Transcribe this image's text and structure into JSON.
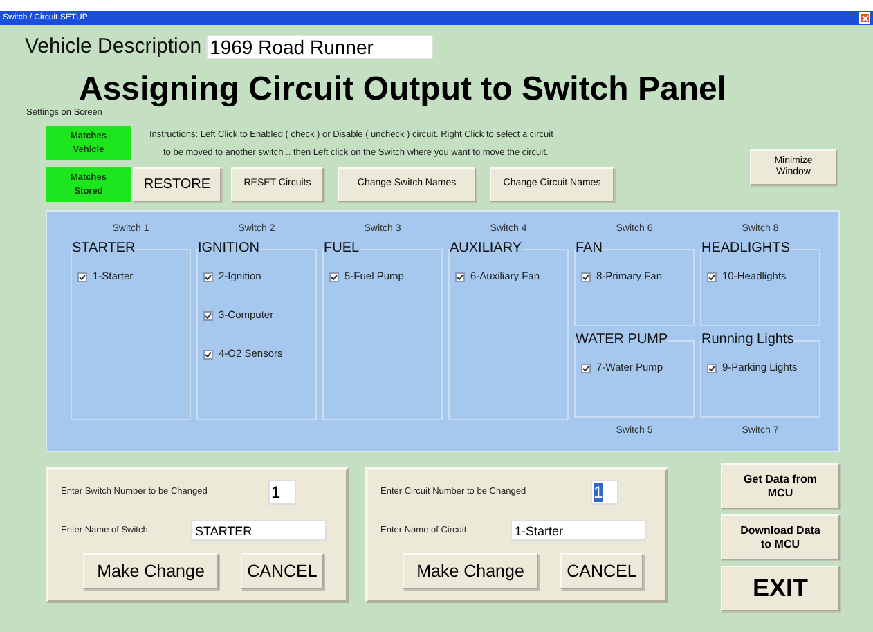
{
  "window": {
    "title": "Switch / Circuit SETUP"
  },
  "vehicle": {
    "label": "Vehicle Description",
    "value": "1969 Road Runner"
  },
  "heading": "Assigning Circuit Output to Switch Panel",
  "settings_label": "Settings on Screen",
  "indicators": [
    {
      "lines": [
        "Matches",
        "Vehicle"
      ],
      "color": "#1ee61e"
    },
    {
      "lines": [
        "Matches",
        "Stored"
      ],
      "color": "#1ee61e"
    }
  ],
  "instructions": [
    "Instructions:   Left Click to Enabled ( check ) or Disable ( uncheck ) circuit.   Right Click to select a circuit",
    "to be moved to another switch  ..  then Left click on the Switch where you want to move the circuit."
  ],
  "toolbar": [
    "RESTORE",
    "RESET Circuits",
    "Change Switch Names",
    "Change Circuit Names"
  ],
  "minimize": [
    "Minimize",
    "Window"
  ],
  "switches": [
    {
      "top_label": "Switch 1",
      "groups": [
        {
          "title": "STARTER",
          "circuits": [
            {
              "label": "1-Starter",
              "checked": true
            }
          ]
        }
      ]
    },
    {
      "top_label": "Switch 2",
      "groups": [
        {
          "title": "IGNITION",
          "circuits": [
            {
              "label": "2-Ignition",
              "checked": true
            },
            {
              "label": "3-Computer",
              "checked": true
            },
            {
              "label": "4-O2 Sensors",
              "checked": true
            }
          ]
        }
      ]
    },
    {
      "top_label": "Switch 3",
      "groups": [
        {
          "title": "FUEL",
          "circuits": [
            {
              "label": "5-Fuel Pump",
              "checked": true
            }
          ]
        }
      ]
    },
    {
      "top_label": "Switch 4",
      "groups": [
        {
          "title": "AUXILIARY",
          "circuits": [
            {
              "label": "6-Auxiliary Fan",
              "checked": true
            }
          ]
        }
      ]
    },
    {
      "top_label": "Switch 6",
      "bottom_label": "Switch 5",
      "groups": [
        {
          "title": "FAN",
          "circuits": [
            {
              "label": "8-Primary Fan",
              "checked": true
            }
          ]
        },
        {
          "title": "WATER PUMP",
          "circuits": [
            {
              "label": "7-Water Pump",
              "checked": true
            }
          ]
        }
      ]
    },
    {
      "top_label": "Switch 8",
      "bottom_label": "Switch 7",
      "groups": [
        {
          "title": "HEADLIGHTS",
          "circuits": [
            {
              "label": "10-Headlights",
              "checked": true
            }
          ]
        },
        {
          "title": "Running Lights",
          "circuits": [
            {
              "label": "9-Parking Lights",
              "checked": true
            }
          ]
        }
      ]
    }
  ],
  "editors": [
    {
      "number_label": "Enter Switch Number to be Changed",
      "number": "1",
      "number_selected": false,
      "name_label": "Enter Name of Switch",
      "name": "STARTER",
      "buttons": [
        "Make Change",
        "CANCEL"
      ]
    },
    {
      "number_label": "Enter Circuit Number to be Changed",
      "number": "1",
      "number_selected": true,
      "name_label": "Enter Name of Circuit",
      "name": "1-Starter",
      "buttons": [
        "Make Change",
        "CANCEL"
      ]
    }
  ],
  "side_buttons": [
    {
      "lines": [
        "Get Data from",
        "MCU"
      ],
      "kind": "normal"
    },
    {
      "lines": [
        "Download Data",
        "to MCU"
      ],
      "kind": "normal"
    },
    {
      "lines": [
        "EXIT"
      ],
      "kind": "large"
    }
  ]
}
